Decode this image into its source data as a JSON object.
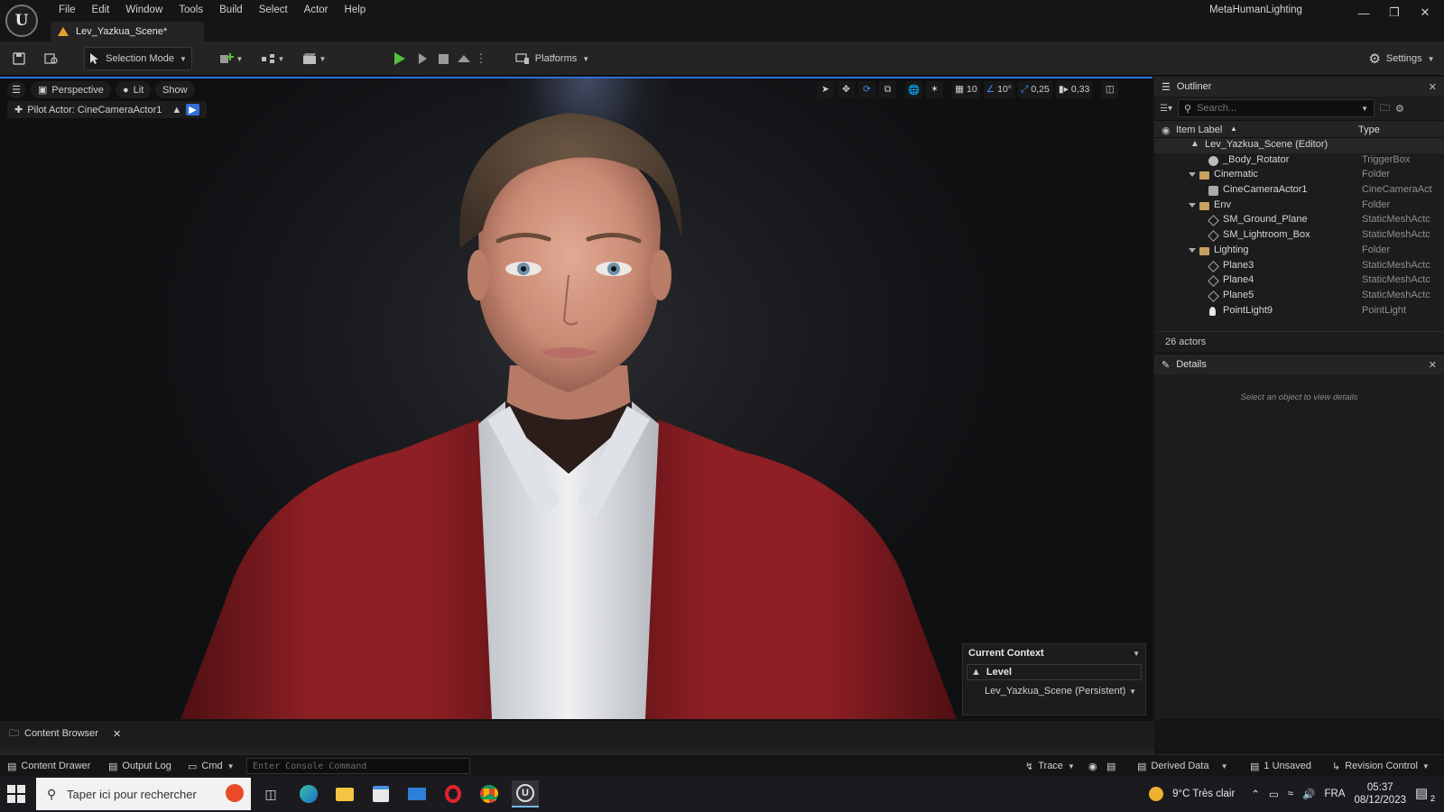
{
  "menu": [
    "File",
    "Edit",
    "Window",
    "Tools",
    "Build",
    "Select",
    "Actor",
    "Help"
  ],
  "document_tab": "Lev_Yazkua_Scene*",
  "project_name": "MetaHumanLighting",
  "toolbar": {
    "selection_mode": "Selection Mode",
    "platforms": "Platforms",
    "settings": "Settings"
  },
  "viewport": {
    "perspective": "Perspective",
    "lit": "Lit",
    "show": "Show",
    "pilot_actor": "Pilot Actor: CineCameraActor1",
    "grid_snap": "10",
    "rotation_snap": "10°",
    "scale_snap": "0,25",
    "camera_speed": "0,33"
  },
  "current_context": {
    "title": "Current Context",
    "level_label": "Level",
    "level_value": "Lev_Yazkua_Scene (Persistent)"
  },
  "outliner": {
    "title": "Outliner",
    "search_placeholder": "Search...",
    "col_label": "Item Label",
    "col_type": "Type",
    "rows": [
      {
        "label": "Lev_Yazkua_Scene (Editor)",
        "type": ""
      },
      {
        "label": "_Body_Rotator",
        "type": "TriggerBox"
      },
      {
        "label": "Cinematic",
        "type": "Folder"
      },
      {
        "label": "CineCameraActor1",
        "type": "CineCameraAct"
      },
      {
        "label": "Env",
        "type": "Folder"
      },
      {
        "label": "SM_Ground_Plane",
        "type": "StaticMeshActc"
      },
      {
        "label": "SM_Lightroom_Box",
        "type": "StaticMeshActc"
      },
      {
        "label": "Lighting",
        "type": "Folder"
      },
      {
        "label": "Plane3",
        "type": "StaticMeshActc"
      },
      {
        "label": "Plane4",
        "type": "StaticMeshActc"
      },
      {
        "label": "Plane5",
        "type": "StaticMeshActc"
      },
      {
        "label": "PointLight9",
        "type": "PointLight"
      }
    ],
    "actor_count": "26 actors"
  },
  "details": {
    "title": "Details",
    "empty_text": "Select an object to view details"
  },
  "content_browser": {
    "tab": "Content Browser"
  },
  "statusbar": {
    "content_drawer": "Content Drawer",
    "output_log": "Output Log",
    "cmd": "Cmd",
    "console_placeholder": "Enter Console Command",
    "trace": "Trace",
    "derived_data": "Derived Data",
    "unsaved": "1 Unsaved",
    "revision_control": "Revision Control"
  },
  "taskbar": {
    "search_placeholder": "Taper ici pour rechercher",
    "weather": "9°C  Très clair",
    "language": "FRA",
    "time": "05:37",
    "date": "08/12/2023",
    "notification_count": "2"
  },
  "colors": {
    "accent_blue": "#2d6fd8",
    "play_green": "#55c040",
    "jacket_red": "#8e1f24"
  }
}
